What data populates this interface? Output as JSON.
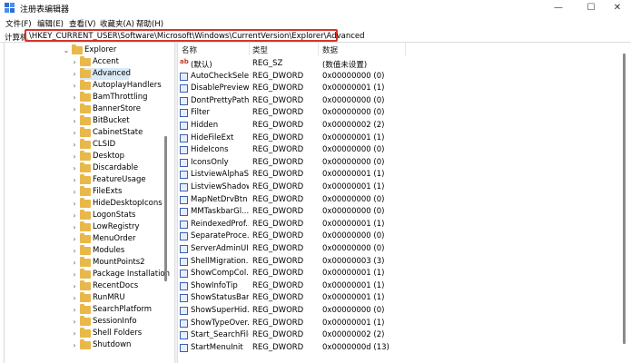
{
  "window": {
    "title": "注册表编辑器",
    "minimize_glyph": "—",
    "maximize_glyph": "☐",
    "close_glyph": "✕"
  },
  "menu": {
    "items": [
      "文件(F)",
      "编辑(E)",
      "查看(V)",
      "收藏夹(A)",
      "帮助(H)"
    ]
  },
  "address": {
    "label": "计算机",
    "path": "\\HKEY_CURRENT_USER\\Software\\Microsoft\\Windows\\CurrentVersion\\Explorer\\Advanced"
  },
  "tree": {
    "items": [
      {
        "label": "Explorer",
        "expanded": true,
        "selected": false,
        "depth": 0
      },
      {
        "label": "Accent",
        "expanded": false,
        "selected": false,
        "depth": 1
      },
      {
        "label": "Advanced",
        "expanded": false,
        "selected": true,
        "depth": 1
      },
      {
        "label": "AutoplayHandlers",
        "expanded": false,
        "selected": false,
        "depth": 1
      },
      {
        "label": "BamThrottling",
        "expanded": false,
        "selected": false,
        "depth": 1
      },
      {
        "label": "BannerStore",
        "expanded": false,
        "selected": false,
        "depth": 1
      },
      {
        "label": "BitBucket",
        "expanded": false,
        "selected": false,
        "depth": 1
      },
      {
        "label": "CabinetState",
        "expanded": false,
        "selected": false,
        "depth": 1
      },
      {
        "label": "CLSID",
        "expanded": false,
        "selected": false,
        "depth": 1
      },
      {
        "label": "Desktop",
        "expanded": false,
        "selected": false,
        "depth": 1
      },
      {
        "label": "Discardable",
        "expanded": false,
        "selected": false,
        "depth": 1
      },
      {
        "label": "FeatureUsage",
        "expanded": false,
        "selected": false,
        "depth": 1
      },
      {
        "label": "FileExts",
        "expanded": false,
        "selected": false,
        "depth": 1
      },
      {
        "label": "HideDesktopIcons",
        "expanded": false,
        "selected": false,
        "depth": 1
      },
      {
        "label": "LogonStats",
        "expanded": false,
        "selected": false,
        "depth": 1
      },
      {
        "label": "LowRegistry",
        "expanded": false,
        "selected": false,
        "depth": 1
      },
      {
        "label": "MenuOrder",
        "expanded": false,
        "selected": false,
        "depth": 1
      },
      {
        "label": "Modules",
        "expanded": false,
        "selected": false,
        "depth": 1
      },
      {
        "label": "MountPoints2",
        "expanded": false,
        "selected": false,
        "depth": 1
      },
      {
        "label": "Package Installation",
        "expanded": false,
        "selected": false,
        "depth": 1
      },
      {
        "label": "RecentDocs",
        "expanded": false,
        "selected": false,
        "depth": 1
      },
      {
        "label": "RunMRU",
        "expanded": false,
        "selected": false,
        "depth": 1
      },
      {
        "label": "SearchPlatform",
        "expanded": false,
        "selected": false,
        "depth": 1
      },
      {
        "label": "SessionInfo",
        "expanded": false,
        "selected": false,
        "depth": 1
      },
      {
        "label": "Shell Folders",
        "expanded": false,
        "selected": false,
        "depth": 1
      },
      {
        "label": "Shutdown",
        "expanded": false,
        "selected": false,
        "depth": 1
      }
    ]
  },
  "list": {
    "columns": [
      "名称",
      "类型",
      "数据"
    ],
    "rows": [
      {
        "name": "(默认)",
        "type": "REG_SZ",
        "data": "(数值未设置)",
        "icon": "string-value-icon"
      },
      {
        "name": "AutoCheckSelect",
        "type": "REG_DWORD",
        "data": "0x00000000 (0)",
        "icon": "dword-value-icon"
      },
      {
        "name": "DisablePreview...",
        "type": "REG_DWORD",
        "data": "0x00000001 (1)",
        "icon": "dword-value-icon"
      },
      {
        "name": "DontPrettyPath",
        "type": "REG_DWORD",
        "data": "0x00000000 (0)",
        "icon": "dword-value-icon"
      },
      {
        "name": "Filter",
        "type": "REG_DWORD",
        "data": "0x00000000 (0)",
        "icon": "dword-value-icon"
      },
      {
        "name": "Hidden",
        "type": "REG_DWORD",
        "data": "0x00000002 (2)",
        "icon": "dword-value-icon"
      },
      {
        "name": "HideFileExt",
        "type": "REG_DWORD",
        "data": "0x00000001 (1)",
        "icon": "dword-value-icon"
      },
      {
        "name": "HideIcons",
        "type": "REG_DWORD",
        "data": "0x00000000 (0)",
        "icon": "dword-value-icon"
      },
      {
        "name": "IconsOnly",
        "type": "REG_DWORD",
        "data": "0x00000000 (0)",
        "icon": "dword-value-icon"
      },
      {
        "name": "ListviewAlphaS...",
        "type": "REG_DWORD",
        "data": "0x00000001 (1)",
        "icon": "dword-value-icon"
      },
      {
        "name": "ListviewShadow",
        "type": "REG_DWORD",
        "data": "0x00000001 (1)",
        "icon": "dword-value-icon"
      },
      {
        "name": "MapNetDrvBtn",
        "type": "REG_DWORD",
        "data": "0x00000000 (0)",
        "icon": "dword-value-icon"
      },
      {
        "name": "MMTaskbarGl...",
        "type": "REG_DWORD",
        "data": "0x00000000 (0)",
        "icon": "dword-value-icon"
      },
      {
        "name": "ReindexedProf...",
        "type": "REG_DWORD",
        "data": "0x00000001 (1)",
        "icon": "dword-value-icon"
      },
      {
        "name": "SeparateProce...",
        "type": "REG_DWORD",
        "data": "0x00000000 (0)",
        "icon": "dword-value-icon"
      },
      {
        "name": "ServerAdminUI",
        "type": "REG_DWORD",
        "data": "0x00000000 (0)",
        "icon": "dword-value-icon"
      },
      {
        "name": "ShellMigration...",
        "type": "REG_DWORD",
        "data": "0x00000003 (3)",
        "icon": "dword-value-icon"
      },
      {
        "name": "ShowCompCol...",
        "type": "REG_DWORD",
        "data": "0x00000001 (1)",
        "icon": "dword-value-icon"
      },
      {
        "name": "ShowInfoTip",
        "type": "REG_DWORD",
        "data": "0x00000001 (1)",
        "icon": "dword-value-icon"
      },
      {
        "name": "ShowStatusBar",
        "type": "REG_DWORD",
        "data": "0x00000001 (1)",
        "icon": "dword-value-icon"
      },
      {
        "name": "ShowSuperHid...",
        "type": "REG_DWORD",
        "data": "0x00000000 (0)",
        "icon": "dword-value-icon"
      },
      {
        "name": "ShowTypeOver...",
        "type": "REG_DWORD",
        "data": "0x00000001 (1)",
        "icon": "dword-value-icon"
      },
      {
        "name": "Start_SearchFiles",
        "type": "REG_DWORD",
        "data": "0x00000002 (2)",
        "icon": "dword-value-icon"
      },
      {
        "name": "StartMenuInit",
        "type": "REG_DWORD",
        "data": "0x0000000d (13)",
        "icon": "dword-value-icon"
      }
    ]
  }
}
